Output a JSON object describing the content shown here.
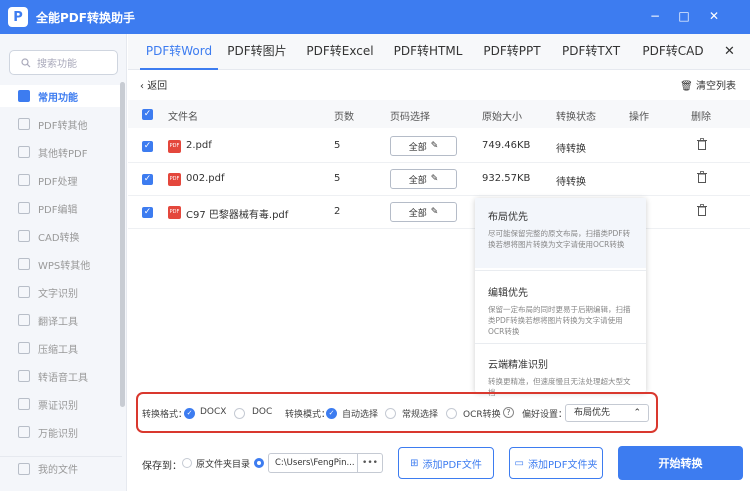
{
  "app": {
    "title": "全能PDF转换助手",
    "logo": "P"
  },
  "window": {
    "minimize": "−",
    "restore": "□",
    "close": "✕"
  },
  "sidebar": {
    "search_placeholder": "搜索功能",
    "items": [
      {
        "label": "常用功能",
        "active": true
      },
      {
        "label": "PDF转其他"
      },
      {
        "label": "其他转PDF"
      },
      {
        "label": "PDF处理"
      },
      {
        "label": "PDF编辑"
      },
      {
        "label": "CAD转换"
      },
      {
        "label": "WPS转其他"
      },
      {
        "label": "文字识别"
      },
      {
        "label": "翻译工具"
      },
      {
        "label": "压缩工具"
      },
      {
        "label": "转语音工具"
      },
      {
        "label": "票证识别"
      },
      {
        "label": "万能识别"
      }
    ],
    "bottom_item": "我的文件"
  },
  "tabs": [
    {
      "label": "PDF转Word",
      "active": true
    },
    {
      "label": "PDF转图片"
    },
    {
      "label": "PDF转Excel"
    },
    {
      "label": "PDF转HTML"
    },
    {
      "label": "PDF转PPT"
    },
    {
      "label": "PDF转TXT"
    },
    {
      "label": "PDF转CAD"
    }
  ],
  "toolbar": {
    "back": "返回",
    "clear": "清空列表"
  },
  "table": {
    "headers": {
      "name": "文件名",
      "pages": "页数",
      "range": "页码选择",
      "size": "原始大小",
      "status": "转换状态",
      "action": "操作",
      "delete": "删除"
    },
    "rows": [
      {
        "name": "2.pdf",
        "pages": "5",
        "range": "全部",
        "size": "749.46KB",
        "status": "待转换"
      },
      {
        "name": "002.pdf",
        "pages": "5",
        "range": "全部",
        "size": "932.57KB",
        "status": "待转换"
      },
      {
        "name": "C97 巴黎器械有毒.pdf",
        "pages": "2",
        "range": "全部",
        "size": "",
        "status": ""
      }
    ]
  },
  "popup": {
    "options": [
      {
        "name": "布局优先",
        "desc": "尽可能保留完整的原文布局，扫描类PDF转换若想将图片转换为文字请使用OCR转换",
        "selected": true
      },
      {
        "name": "编辑优先",
        "desc": "保留一定布局的同时更易于后期编辑，扫描类PDF转换若想将图片转换为文字请使用OCR转换"
      },
      {
        "name": "云端精准识别",
        "desc": "转换更精准，但速度慢且无法处理超大型文档"
      }
    ]
  },
  "settings": {
    "format_label": "转换格式：",
    "format_docx": "DOCX",
    "format_doc": "DOC",
    "mode_label": "转换模式：",
    "mode_auto": "自动选择",
    "mode_normal": "常规选择",
    "mode_ocr": "OCR转换",
    "pref_label": "偏好设置：",
    "pref_value": "布局优先"
  },
  "bottom": {
    "save_label": "保存到：",
    "source_dir": "原文件夹目录",
    "path": "C:\\Users\\FengPin...",
    "browse": "•••",
    "add_file": "添加PDF文件",
    "add_folder": "添加PDF文件夹",
    "start": "开始转换"
  },
  "colors": {
    "accent": "#3d7cf0",
    "highlight_border": "#d9382e",
    "pdf_icon": "#e4473c"
  }
}
